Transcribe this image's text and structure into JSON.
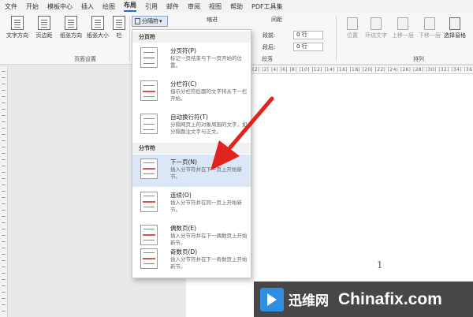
{
  "menu": [
    "文件",
    "开始",
    "模板中心",
    "插入",
    "绘图",
    "布局",
    "引用",
    "邮件",
    "审阅",
    "视图",
    "帮助",
    "PDF工具集"
  ],
  "menu_active_index": 5,
  "ribbon": {
    "page_setup_buttons": [
      "文字方向",
      "页边距",
      "纸张方向",
      "纸张大小",
      "栏"
    ],
    "page_setup_label": "页面设置",
    "breaks_button": "分隔符",
    "indent_label": "缩进",
    "spacing_label": "间距",
    "spacing_before_label": "段前:",
    "spacing_before_value": "0 行",
    "spacing_after_label": "段后:",
    "spacing_after_value": "0 行",
    "paragraph_label": "段落",
    "arrange_buttons": [
      "位置",
      "环绕文字",
      "上移一层",
      "下移一层",
      "选择窗格"
    ],
    "arrange_label": "排列"
  },
  "ruler_text": "(2| |2| |4| |6| |8| |10| |12| |14| |16| |18| |20| |22| |24| |26| |28| |30| |32| |34| |36| |38|",
  "dropdown": {
    "page_breaks_header": "分页符",
    "section_breaks_header": "分节符",
    "items": [
      {
        "title": "分页符(P)",
        "desc": "标记一页结束与下一页开始的位置。"
      },
      {
        "title": "分栏符(C)",
        "desc": "指示分栏符后面的文字将从下一栏开始。"
      },
      {
        "title": "自动换行符(T)",
        "desc": "分隔网页上的对象周围的文字，如分隔题注文字与正文。"
      },
      {
        "title": "下一页(N)",
        "desc": "插入分节符并在下一页上开始新节。"
      },
      {
        "title": "连续(O)",
        "desc": "插入分节符并在同一页上开始新节。"
      },
      {
        "title": "偶数页(E)",
        "desc": "插入分节符并在下一偶数页上开始新节。"
      },
      {
        "title": "奇数页(D)",
        "desc": "插入分节符并在下一奇数页上开始新节。"
      }
    ],
    "highlighted_index": 3
  },
  "page_number": "1",
  "watermark": {
    "cn": "迅维网",
    "en": "Chinafix.com"
  },
  "colors": {
    "accent": "#2b6cc4",
    "highlight": "#dbe7f6",
    "arrow": "#e0231c"
  }
}
